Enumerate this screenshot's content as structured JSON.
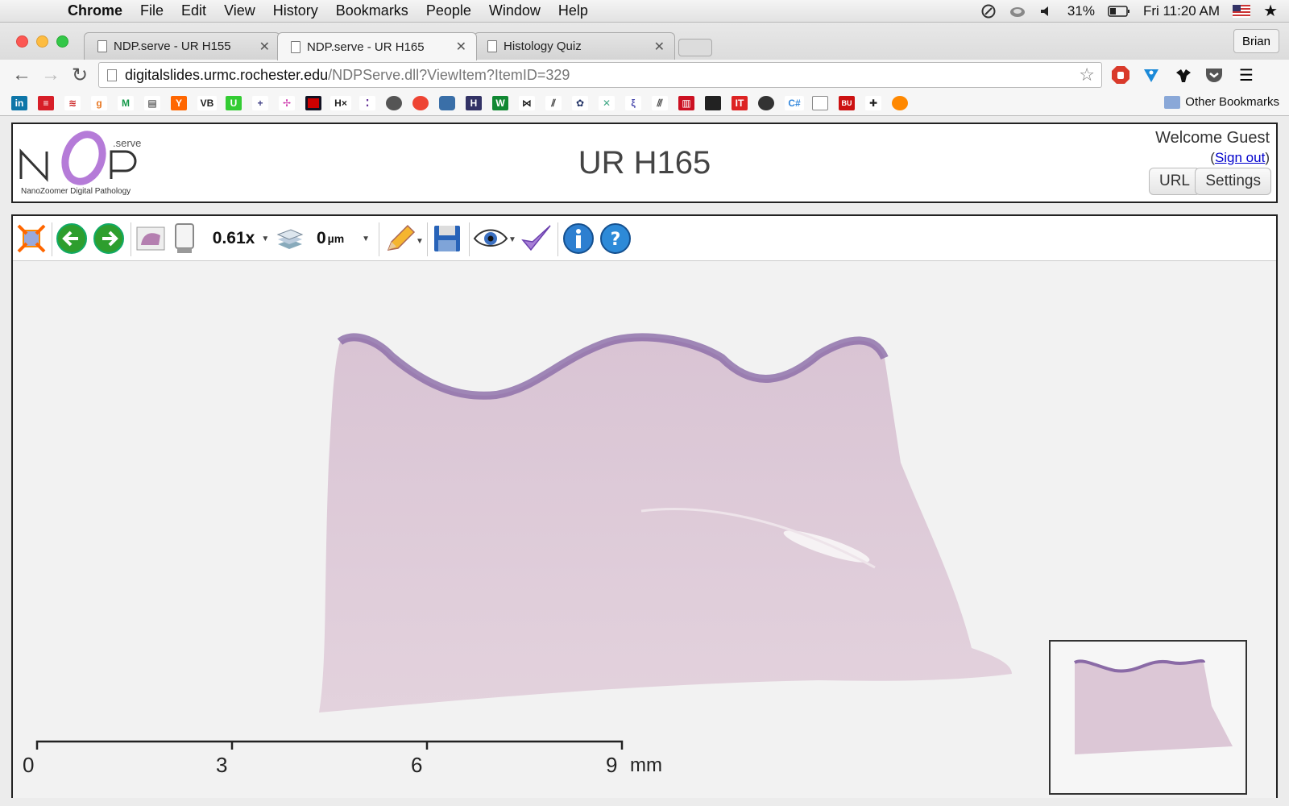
{
  "menubar": {
    "app": "Chrome",
    "items": [
      "File",
      "Edit",
      "View",
      "History",
      "Bookmarks",
      "People",
      "Window",
      "Help"
    ],
    "battery": "31%",
    "clock": "Fri 11:20 AM"
  },
  "browser": {
    "tabs": [
      {
        "title": "NDP.serve - UR H155"
      },
      {
        "title": "NDP.serve - UR H165"
      },
      {
        "title": "Histology Quiz"
      }
    ],
    "profile": "Brian",
    "url_host": "digitalslides.urmc.rochester.edu",
    "url_path": "/NDPServe.dll?ViewItem?ItemID=329",
    "other_bookmarks": "Other Bookmarks"
  },
  "header": {
    "logo_text": "NanoZoomer Digital Pathology",
    "logo_serve": ".serve",
    "title": "UR H165",
    "welcome": "Welcome Guest",
    "signout": "Sign out",
    "url_button": "URL",
    "settings_button": "Settings"
  },
  "viewer": {
    "magnification": "0.61x",
    "focus_value": "0",
    "focus_unit": "µm",
    "scale": {
      "labels": [
        "0",
        "3",
        "6",
        "9"
      ],
      "unit": "mm"
    }
  }
}
